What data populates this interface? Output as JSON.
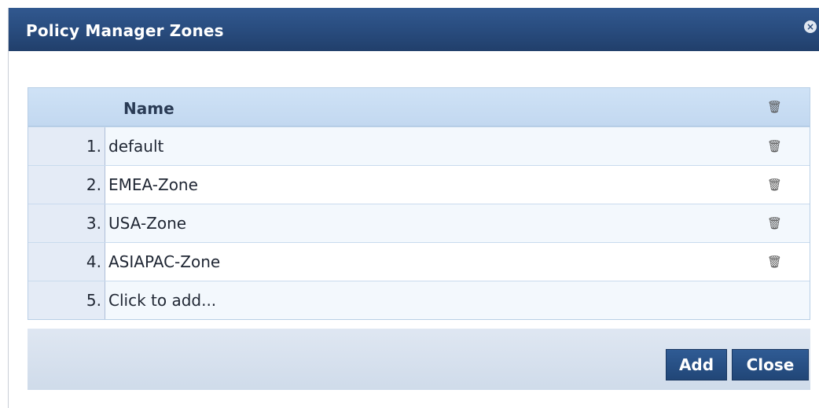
{
  "dialog": {
    "title": "Policy Manager Zones",
    "close_icon": "×"
  },
  "table": {
    "column_header": "Name",
    "trash_icon": "🗑",
    "rows": [
      {
        "index": "1.",
        "name": "default"
      },
      {
        "index": "2.",
        "name": "EMEA-Zone"
      },
      {
        "index": "3.",
        "name": "USA-Zone"
      },
      {
        "index": "4.",
        "name": "ASIAPAC-Zone"
      },
      {
        "index": "5.",
        "name": "Click to add..."
      }
    ]
  },
  "buttons": {
    "add_label": "Add",
    "close_label": "Close"
  },
  "colors": {
    "titlebar": "#284b7d",
    "header": "#c7dcf2",
    "button": "#264f85"
  }
}
